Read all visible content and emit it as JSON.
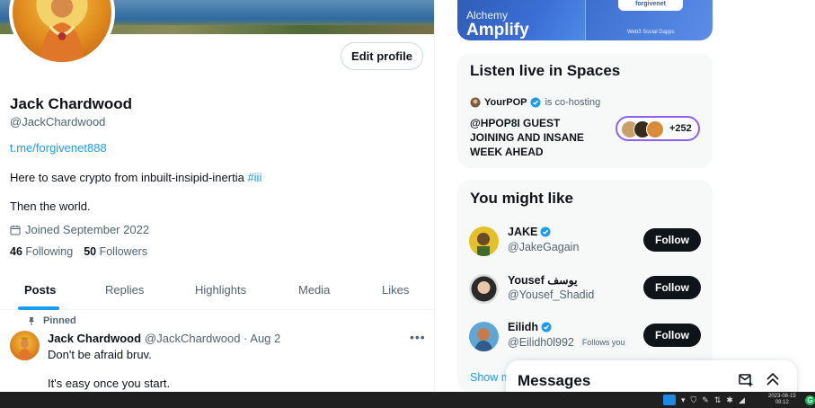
{
  "profile": {
    "name": "Jack Chardwood",
    "handle": "@JackChardwood",
    "link": "t.me/forgivenet888",
    "bio_text": "Here to save crypto from inbuilt-insipid-inertia ",
    "bio_tag": "#iii",
    "bio_line2": "Then the world.",
    "joined": "Joined September 2022",
    "following_count": "46",
    "following_label": "Following",
    "followers_count": "50",
    "followers_label": "Followers",
    "edit_button": "Edit profile"
  },
  "tabs": [
    "Posts",
    "Replies",
    "Highlights",
    "Media",
    "Likes"
  ],
  "active_tab": "Posts",
  "pinned_tweet": {
    "pinned_label": "Pinned",
    "author": "Jack Chardwood",
    "meta": "@JackChardwood · Aug 2",
    "text_line1": "Don't be afraid bruv.",
    "text_line2": "It's easy once you start."
  },
  "promo": {
    "line1": "Alchemy",
    "line2": "Amplify",
    "pill": "forgivenet",
    "caption": "Web3 Social Dapps"
  },
  "spaces": {
    "title": "Listen live in Spaces",
    "host_name": "YourPOP",
    "host_suffix": "is co-hosting",
    "space_title": "@HPOP8I GUEST JOINING AND INSANE WEEK AHEAD",
    "listener_count": "+252"
  },
  "you_might_like": {
    "title": "You might like",
    "users": [
      {
        "name": "JAKE",
        "handle": "@JakeGagain",
        "follows_you": "",
        "button": "Follow"
      },
      {
        "name": "Yousef يوسف",
        "handle": "@Yousef_Shadid",
        "follows_you": "",
        "button": "Follow"
      },
      {
        "name": "Eilidh",
        "handle": "@Eilidh0l992",
        "follows_you": "Follows you",
        "button": "Follow"
      }
    ],
    "show_more": "Show m"
  },
  "messages": {
    "title": "Messages"
  },
  "taskbar": {
    "date": "2023-08-15",
    "time": "08:12"
  },
  "colors": {
    "accent": "#1d9bf0",
    "text_primary": "#0f1419",
    "text_secondary": "#536471",
    "follow_button": "#0f1419",
    "spaces_ring": "#8d5ef2"
  },
  "icons": [
    "calendar-icon",
    "pin-icon",
    "more-icon",
    "verified-icon",
    "new-message-icon",
    "collapse-icon"
  ]
}
